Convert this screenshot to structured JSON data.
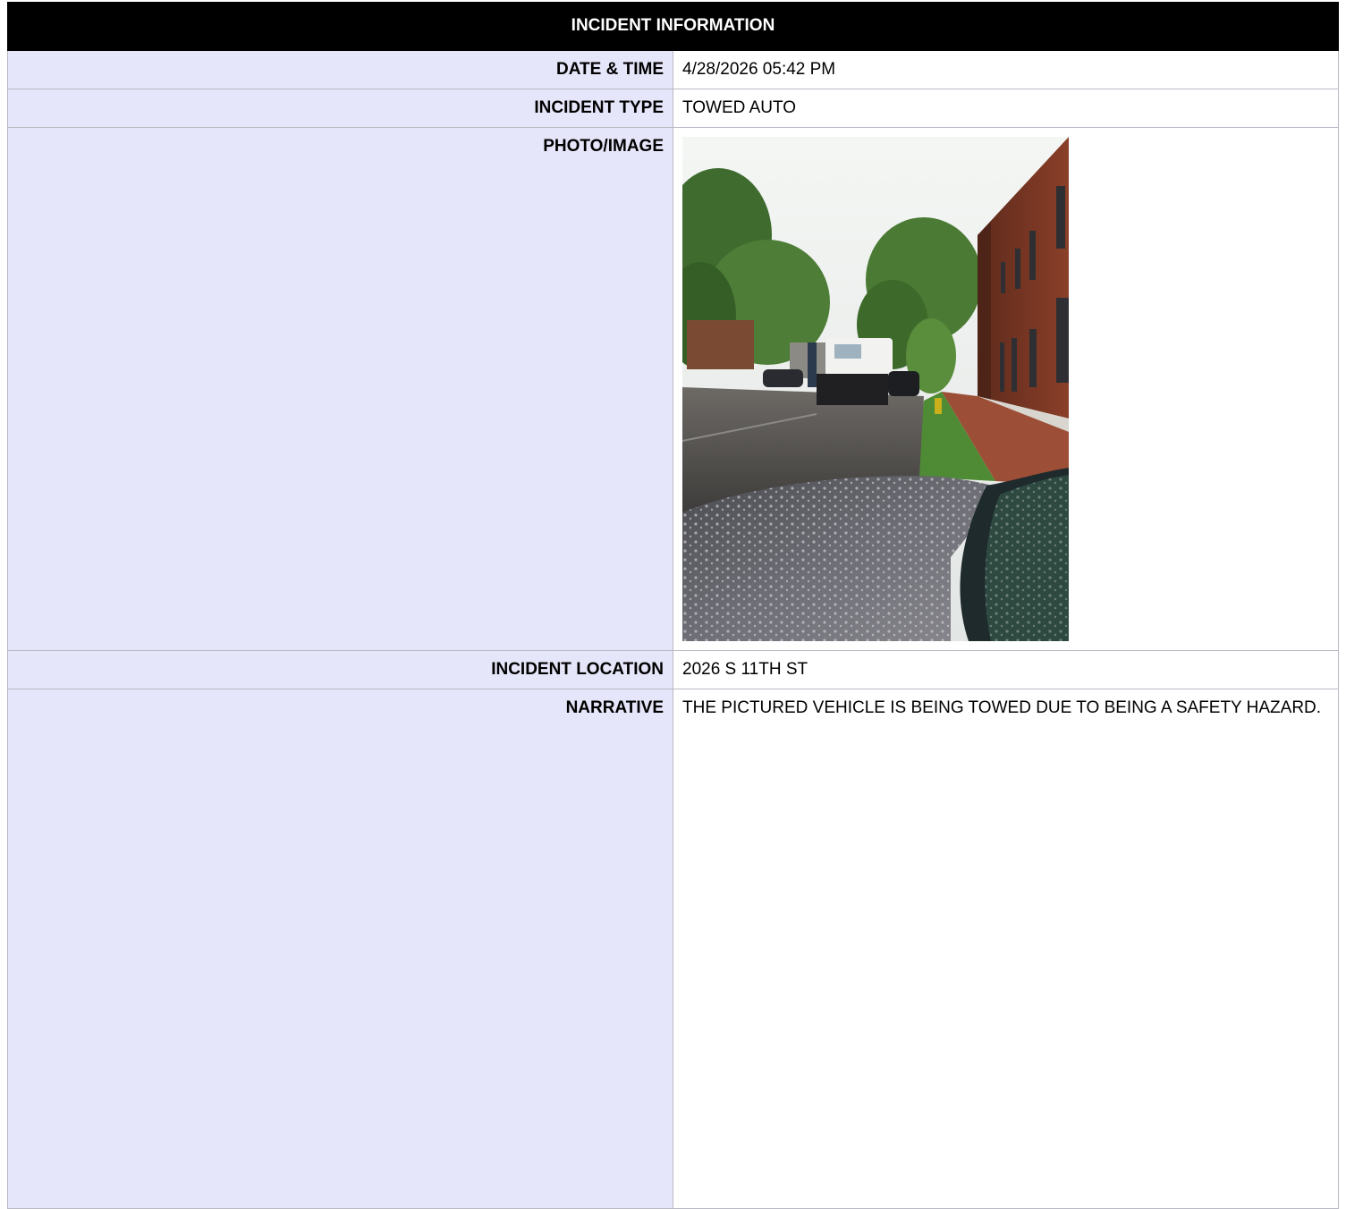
{
  "header": {
    "title": "INCIDENT INFORMATION"
  },
  "rows": {
    "date_time": {
      "label": "DATE & TIME",
      "value": "4/28/2026 05:42 PM"
    },
    "incident_type": {
      "label": "INCIDENT TYPE",
      "value": "TOWED AUTO"
    },
    "photo": {
      "label": "PHOTO/IMAGE"
    },
    "location": {
      "label": "INCIDENT LOCATION",
      "value": "2026 S 11TH ST"
    },
    "narrative": {
      "label": "NARRATIVE",
      "value": "THE PICTURED VEHICLE IS BEING TOWED DUE TO BEING A SAFETY HAZARD."
    }
  },
  "colors": {
    "header_bg": "#000000",
    "label_bg": "#e6e6fa",
    "border": "#b9b9c4"
  }
}
